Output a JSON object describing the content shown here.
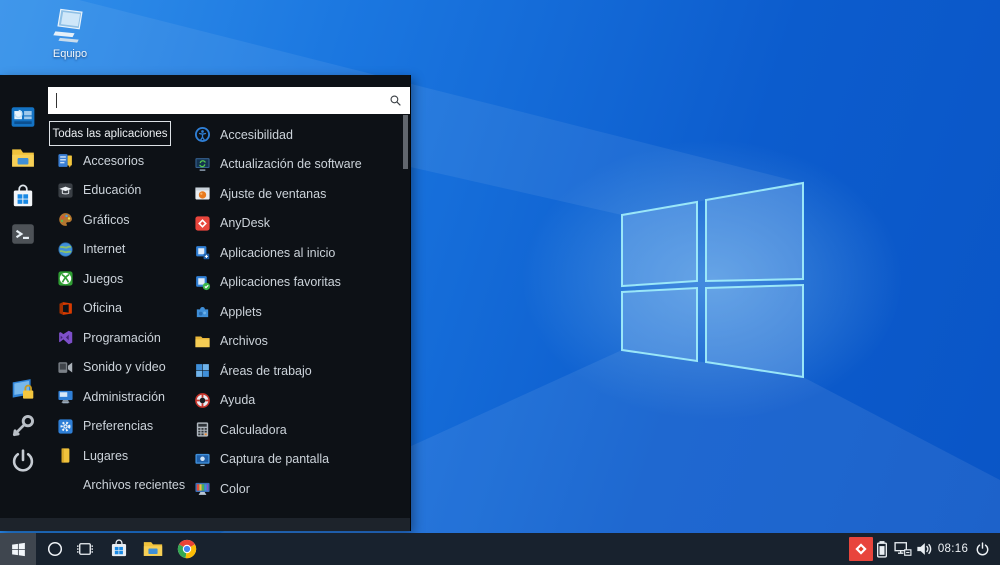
{
  "desktop": {
    "computer_label": "Equipo"
  },
  "start_menu": {
    "search": {
      "value": "",
      "placeholder": ""
    },
    "all_apps_button": "Todas las aplicaciones",
    "favorites": [
      {
        "name": "software-manager",
        "icon": "software-manager-icon"
      },
      {
        "name": "file-manager",
        "icon": "files-icon"
      },
      {
        "name": "store",
        "icon": "store-icon"
      },
      {
        "name": "terminal",
        "icon": "terminal-icon"
      },
      {
        "name": "lock-screen",
        "icon": "lock-screen-icon"
      },
      {
        "name": "logout",
        "icon": "key-icon"
      },
      {
        "name": "shutdown",
        "icon": "power-icon"
      }
    ],
    "categories": [
      {
        "label": "Accesorios",
        "name": "accesorios",
        "icon": "accessories-icon"
      },
      {
        "label": "Educación",
        "name": "educacion",
        "icon": "education-icon"
      },
      {
        "label": "Gráficos",
        "name": "graficos",
        "icon": "graphics-icon"
      },
      {
        "label": "Internet",
        "name": "internet",
        "icon": "internet-icon"
      },
      {
        "label": "Juegos",
        "name": "juegos",
        "icon": "games-icon"
      },
      {
        "label": "Oficina",
        "name": "oficina",
        "icon": "office-icon"
      },
      {
        "label": "Programación",
        "name": "programacion",
        "icon": "programming-icon"
      },
      {
        "label": "Sonido y vídeo",
        "name": "sonido-y-video",
        "icon": "sound-video-icon"
      },
      {
        "label": "Administración",
        "name": "administracion",
        "icon": "administration-icon"
      },
      {
        "label": "Preferencias",
        "name": "preferencias",
        "icon": "preferences-icon"
      },
      {
        "label": "Lugares",
        "name": "lugares",
        "icon": "places-icon"
      },
      {
        "label": "Archivos recientes",
        "name": "archivos-recientes",
        "icon": null
      }
    ],
    "apps": [
      {
        "label": "Accesibilidad",
        "name": "accesibilidad",
        "icon": "accessibility-icon"
      },
      {
        "label": "Actualización de software",
        "name": "actualizacion-de-software",
        "icon": "software-update-icon"
      },
      {
        "label": "Ajuste de ventanas",
        "name": "ajuste-de-ventanas",
        "icon": "window-tweaks-icon"
      },
      {
        "label": "AnyDesk",
        "name": "anydesk",
        "icon": "anydesk-icon"
      },
      {
        "label": "Aplicaciones al inicio",
        "name": "aplicaciones-al-inicio",
        "icon": "startup-apps-icon"
      },
      {
        "label": "Aplicaciones favoritas",
        "name": "aplicaciones-favoritas",
        "icon": "favorite-apps-icon"
      },
      {
        "label": "Applets",
        "name": "applets",
        "icon": "applets-icon"
      },
      {
        "label": "Archivos",
        "name": "archivos",
        "icon": "files-app-icon"
      },
      {
        "label": "Áreas de trabajo",
        "name": "areas-de-trabajo",
        "icon": "workspaces-icon"
      },
      {
        "label": "Ayuda",
        "name": "ayuda",
        "icon": "help-icon"
      },
      {
        "label": "Calculadora",
        "name": "calculadora",
        "icon": "calculator-icon"
      },
      {
        "label": "Captura de pantalla",
        "name": "captura-de-pantalla",
        "icon": "screenshot-icon"
      },
      {
        "label": "Color",
        "name": "color",
        "icon": "color-icon"
      }
    ]
  },
  "taskbar": {
    "buttons": [
      {
        "name": "start",
        "icon": "windows-start-icon"
      },
      {
        "name": "cortana",
        "icon": "circle-icon"
      },
      {
        "name": "task-view",
        "icon": "task-view-icon"
      },
      {
        "name": "store",
        "icon": "store-taskbar-icon"
      },
      {
        "name": "file-explorer",
        "icon": "folder-taskbar-icon"
      },
      {
        "name": "chrome",
        "icon": "chrome-icon"
      }
    ],
    "tray": [
      {
        "name": "anydesk-tray",
        "icon": "anydesk-tray-icon"
      },
      {
        "name": "battery",
        "icon": "battery-icon"
      },
      {
        "name": "network",
        "icon": "network-icon"
      },
      {
        "name": "volume",
        "icon": "volume-icon"
      }
    ],
    "clock": "08:16"
  },
  "colors": {
    "wallpaper_blue": "#1b77e0",
    "menu_background": "#0d1116",
    "taskbar_background": "#18222e",
    "anydesk_red": "#e8453c",
    "accent": "#2f7fd6"
  }
}
